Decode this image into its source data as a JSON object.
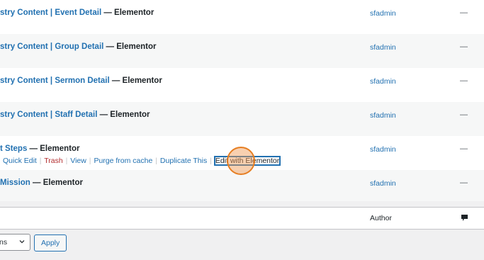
{
  "rows": [
    {
      "title": "stry Content | Event Detail",
      "suffix": " — Elementor",
      "author": "sfadmin",
      "dash": "—"
    },
    {
      "title": "stry Content | Group Detail",
      "suffix": " — Elementor",
      "author": "sfadmin",
      "dash": "—"
    },
    {
      "title": "stry Content | Sermon Detail",
      "suffix": " — Elementor",
      "author": "sfadmin",
      "dash": "—"
    },
    {
      "title": "stry Content | Staff Detail",
      "suffix": " — Elementor",
      "author": "sfadmin",
      "dash": "—"
    },
    {
      "title": "t Steps",
      "suffix": " — Elementor",
      "author": "sfadmin",
      "dash": "—"
    },
    {
      "title": "Mission",
      "suffix": " — Elementor",
      "author": "sfadmin",
      "dash": "—"
    }
  ],
  "row_actions": {
    "quick_edit": "Quick Edit",
    "sep": "|",
    "trash": "Trash",
    "view": "View",
    "purge": "Purge from cache",
    "duplicate": "Duplicate This",
    "edit_elementor": "Edit with Elementor"
  },
  "footer": {
    "author_header": "Author",
    "comment_icon": "comment-bubble-icon"
  },
  "bulk": {
    "select_value": "ns",
    "apply_label": "Apply"
  },
  "colors": {
    "link": "#2271b1",
    "trash": "#b32d2e",
    "marker": "#e67e22"
  }
}
